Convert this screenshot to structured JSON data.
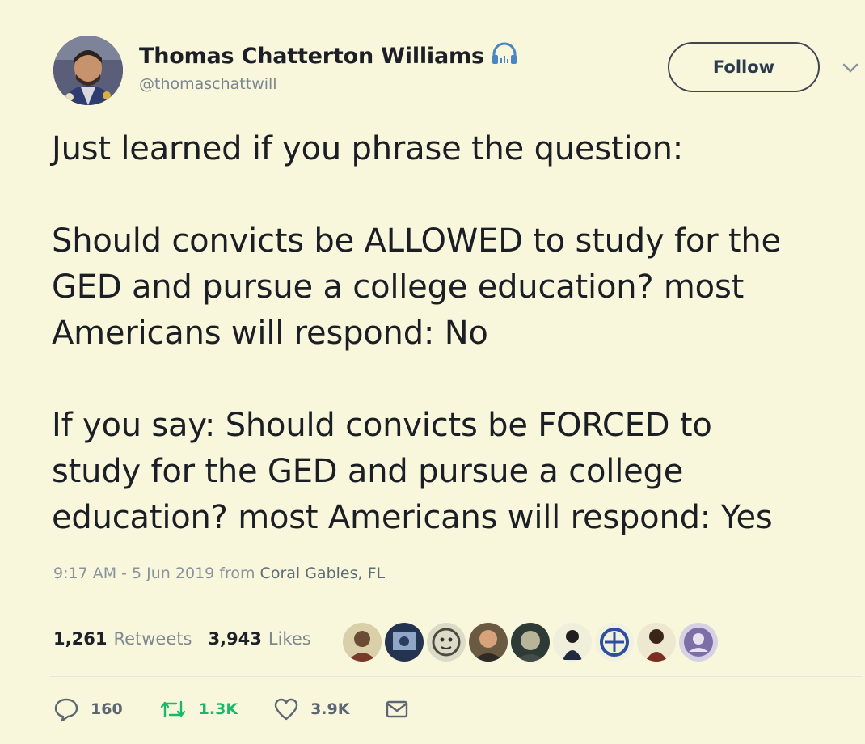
{
  "author": {
    "display_name": "Thomas Chatterton Williams",
    "handle": "@thomaschattwill",
    "badge_icon": "headphones-icon"
  },
  "follow_label": "Follow",
  "text": {
    "p1": "Just learned if you phrase the question:",
    "p2": "Should convicts be ALLOWED to study for the\nGED and pursue a college education? most\nAmericans will respond: No",
    "p3": "If you say: Should convicts be FORCED to\nstudy for the GED and pursue a college\neducation? most Americans will respond: Yes"
  },
  "meta": {
    "timestamp": "9:17 AM - 5 Jun 2019 from",
    "location": "Coral Gables, FL"
  },
  "stats": {
    "retweets_count": "1,261",
    "retweets_label": "Retweets",
    "likes_count": "3,943",
    "likes_label": "Likes"
  },
  "actions": {
    "replies": "160",
    "retweets": "1.3K",
    "likes": "3.9K"
  },
  "colors": {
    "background": "#f8f7dc",
    "retweet_green": "#17b96a",
    "muted_text": "#7b8591"
  }
}
